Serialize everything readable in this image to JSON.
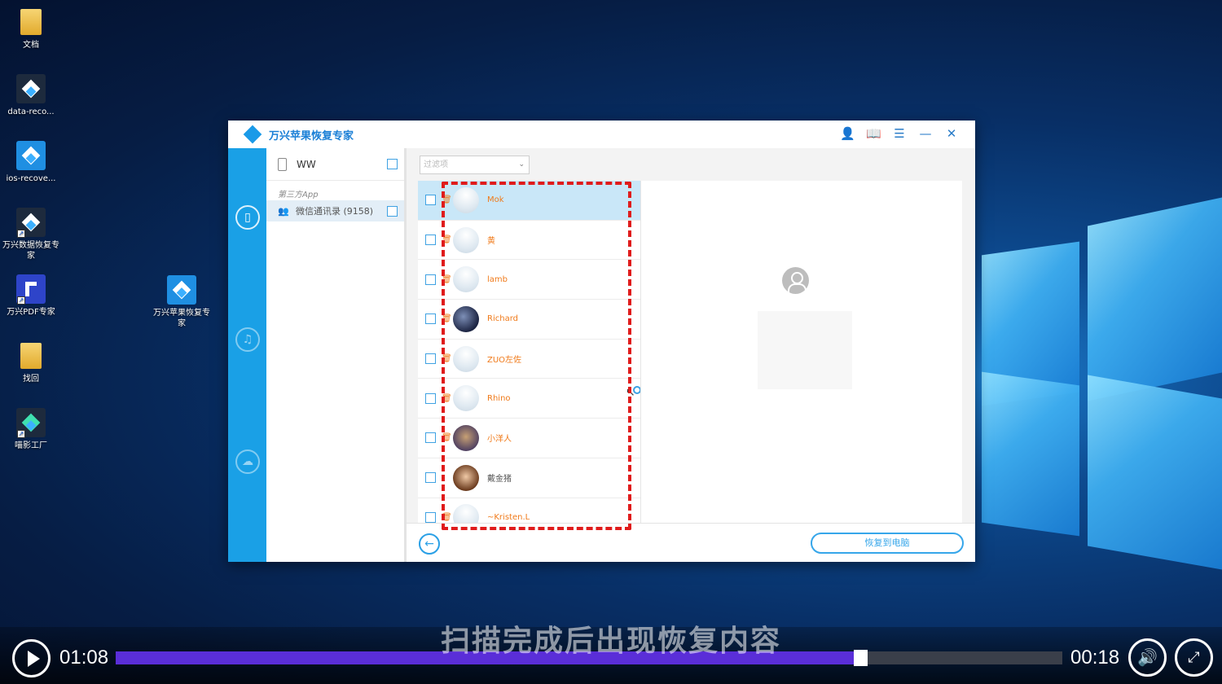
{
  "desktop": {
    "icons": [
      {
        "label": "文档"
      },
      {
        "label": "data-reco..."
      },
      {
        "label": "ios-recove..."
      },
      {
        "label": "万兴数据恢复专家"
      },
      {
        "label": "万兴PDF专家"
      },
      {
        "label": "找回"
      },
      {
        "label": "喵影工厂"
      },
      {
        "label": "万兴苹果恢复专家"
      }
    ]
  },
  "app": {
    "title": "万兴苹果恢复专家",
    "device_name": "WW",
    "section_label": "第三方App",
    "category": {
      "label": "微信通讯录 (9158)"
    },
    "filter_placeholder": "过滤项",
    "contacts": [
      {
        "name": "Mok",
        "selected": true
      },
      {
        "name": "黄"
      },
      {
        "name": "lamb"
      },
      {
        "name": "Richard"
      },
      {
        "name": "ZUO左佐"
      },
      {
        "name": "Rhino"
      },
      {
        "name": "小洋人"
      },
      {
        "name": "戴金猪"
      },
      {
        "name": "~Kristen.L"
      }
    ],
    "restore_button": "恢复到电脑"
  },
  "video": {
    "subtitle": "扫描完成后出现恢复内容",
    "current_time": "01:08",
    "remaining_time": "00:18",
    "progress": 0.78
  },
  "colors": {
    "accent": "#1aa0e6",
    "highlight_box": "#e01b1b",
    "progress_fill": "#5a2ed8"
  }
}
